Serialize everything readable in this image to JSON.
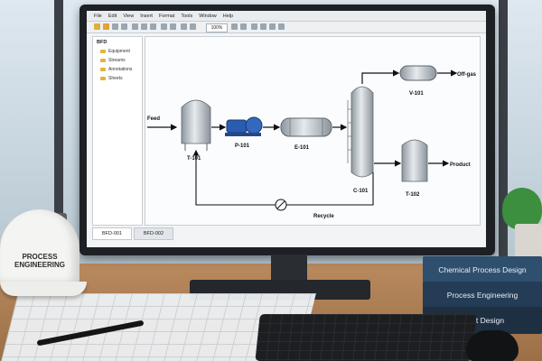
{
  "app": {
    "menu": [
      "File",
      "Edit",
      "View",
      "Insert",
      "Format",
      "Tools",
      "Window",
      "Help"
    ],
    "zoom": "100%",
    "sidebar": {
      "title": "BFD",
      "items": [
        "Equipment",
        "Streams",
        "Annotations",
        "Sheets"
      ]
    },
    "tabs": [
      "BFD-001",
      "BFD-002"
    ],
    "active_tab": "BFD-001"
  },
  "diagram": {
    "feed_label": "Feed",
    "offgas_label": "Off-gas",
    "product_label": "Product",
    "recycle_label": "Recycle",
    "units": {
      "t101": "T-101",
      "p101": "P-101",
      "e101": "E-101",
      "c101": "C-101",
      "v101": "V-101",
      "t102": "T-102"
    }
  },
  "scene": {
    "hardhat_text": "PROCESS\nENGINEERING",
    "books": [
      "Chemical Process Design",
      "Process Engineering",
      "Plant Design"
    ]
  },
  "colors": {
    "pump": "#2a5db0",
    "vessel": "#b9c0c7",
    "monitor": "#1d2024"
  }
}
